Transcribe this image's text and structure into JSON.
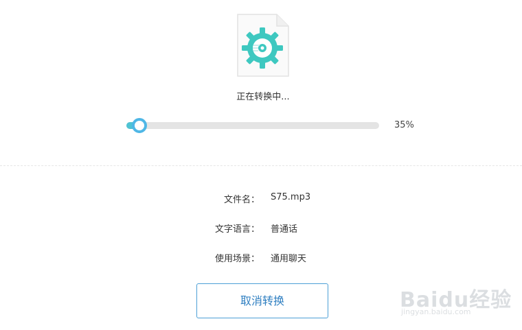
{
  "conversion": {
    "status_text": "正在转换中...",
    "progress_value": 0.35,
    "progress_percent": "35%"
  },
  "file_info": {
    "rows": [
      {
        "label": "文件名：",
        "value": "S75.mp3"
      },
      {
        "label": "文字语言：",
        "value": "普通话"
      },
      {
        "label": "使用场景：",
        "value": "通用聊天"
      }
    ]
  },
  "actions": {
    "cancel_label": "取消转换"
  },
  "watermark": {
    "text": "Baidu经验",
    "url": "jingyan.baidu.com"
  },
  "colors": {
    "accent": "#4fc3d3",
    "knob_border": "#4fb7e6",
    "button_border": "#4b9fd6",
    "button_text": "#2f7fc1",
    "track": "#e4e4e4"
  },
  "icons": {
    "file": "audio-file-gear-icon"
  }
}
